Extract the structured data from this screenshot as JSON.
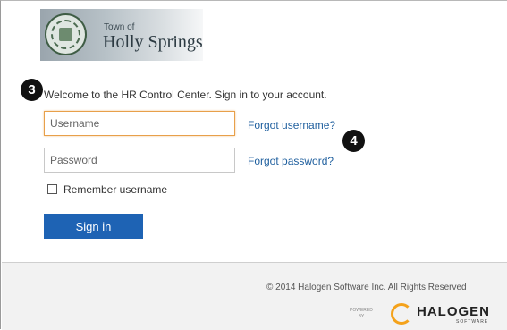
{
  "header": {
    "town_of": "Town of",
    "town_name": "Holly Springs",
    "seal_icon": "town-seal-icon"
  },
  "callouts": {
    "step_3": "3",
    "step_4": "4"
  },
  "login": {
    "welcome_text": "Welcome to the HR Control Center. Sign in to your account.",
    "username": {
      "value": "",
      "placeholder": "Username"
    },
    "password": {
      "value": "",
      "placeholder": "Password"
    },
    "forgot_username": "Forgot username?",
    "forgot_password": "Forgot password?",
    "remember_label": "Remember username",
    "remember_checked": false,
    "sign_in_label": "Sign in"
  },
  "footer": {
    "copyright": "© 2014 Halogen Software Inc. All Rights Reserved",
    "powered_by_line1": "POWERED",
    "powered_by_line2": "BY",
    "brand": "HALOGEN",
    "brand_sub": "SOFTWARE"
  },
  "colors": {
    "sign_in_button": "#1e63b4",
    "link": "#1f5f9e",
    "focus_border": "#e8a04a",
    "halogen_accent": "#f4a21b"
  }
}
